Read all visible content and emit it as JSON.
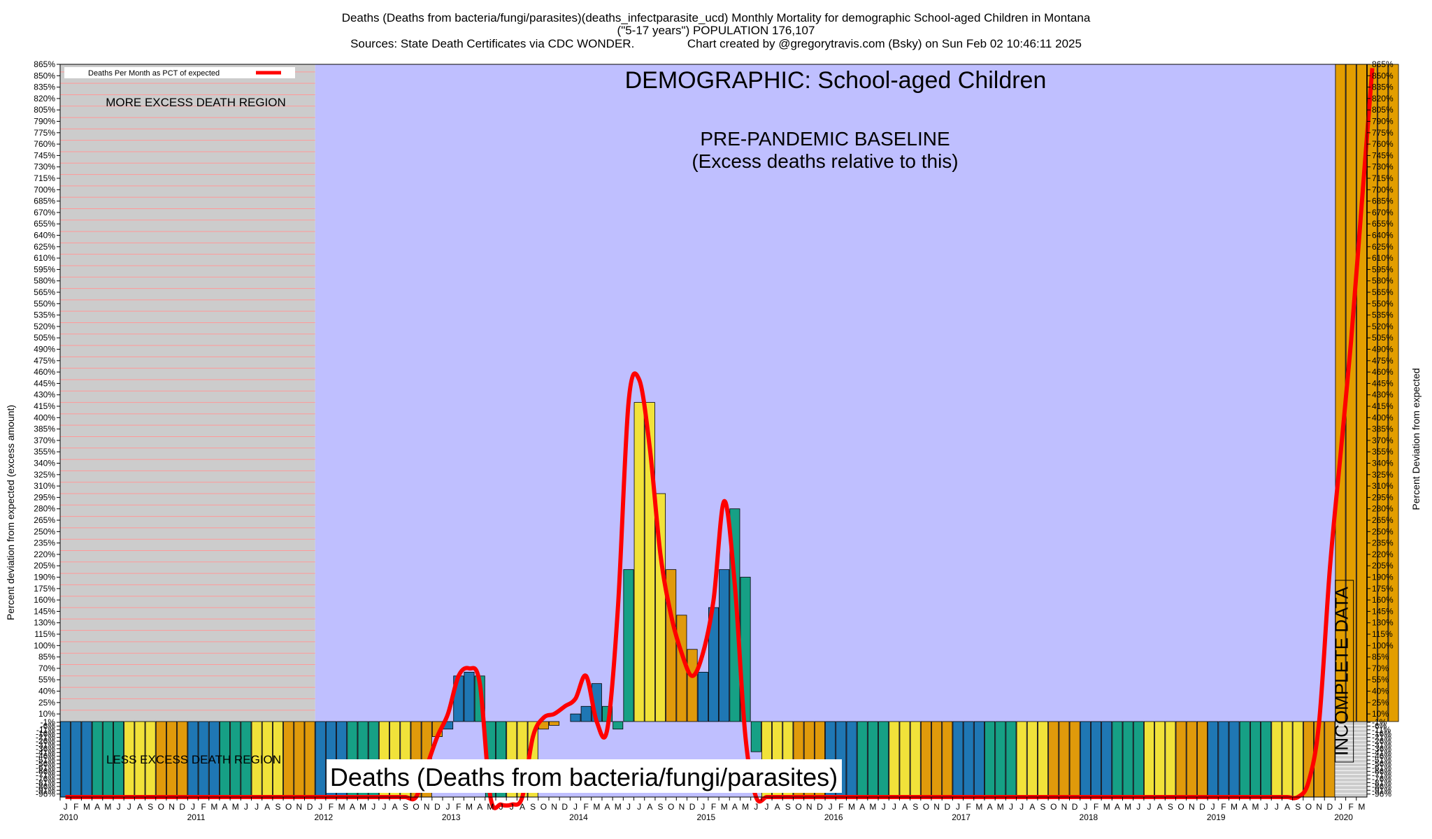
{
  "header": {
    "line1": "Deaths (Deaths from bacteria/fungi/parasites)(deaths_infectparasite_ucd) Monthly Mortality for demographic School-aged Children in Montana",
    "line2": "(\"5-17 years\") POPULATION 176,107",
    "line3": "Sources: State Death Certificates via CDC WONDER.                Chart created by @gregorytravis.com (Bsky) on Sun Feb 02 10:46:11 2025"
  },
  "chart_data": {
    "type": "bar",
    "title": "DEMOGRAPHIC: School-aged Children",
    "ylabel": "Percent deviation from expected (excess amount)",
    "ylabel_right": "Percent Deviation from expected",
    "ylim": [
      -100,
      865
    ],
    "legend": {
      "label": "Deaths Per Month as PCT of expected",
      "placement": "top-left"
    },
    "annotations": {
      "more_excess": "MORE EXCESS DEATH REGION",
      "less_excess": "LESS EXCESS DEATH REGION",
      "baseline_line1": "PRE-PANDEMIC BASELINE",
      "baseline_line2": "(Excess deaths relative to this)",
      "incomplete": "INCOMPLETE DATA",
      "bottom_title": "Deaths (Deaths from bacteria/fungi/parasites)"
    },
    "month_letters": [
      "J",
      "F",
      "M",
      "A",
      "M",
      "J",
      "J",
      "A",
      "S",
      "O",
      "N",
      "D"
    ],
    "year_labels": [
      "2010",
      "2011",
      "2012",
      "2013",
      "2014",
      "2015",
      "2016",
      "2017",
      "2018",
      "2019",
      "2020"
    ],
    "start": "2010-01",
    "values": [
      -100,
      -100,
      -100,
      -100,
      -100,
      -100,
      -100,
      -100,
      -100,
      -100,
      -100,
      -100,
      -100,
      -100,
      -100,
      -100,
      -100,
      -100,
      -100,
      -100,
      -100,
      -100,
      -100,
      -100,
      -100,
      -100,
      -100,
      -100,
      -100,
      -100,
      -100,
      -100,
      -100,
      -100,
      -100,
      -20,
      -10,
      60,
      65,
      60,
      -100,
      -100,
      -100,
      -100,
      -100,
      -10,
      -5,
      0,
      10,
      20,
      50,
      20,
      -10,
      200,
      420,
      420,
      300,
      200,
      140,
      95,
      65,
      150,
      200,
      280,
      190,
      -40,
      -100,
      -100,
      -100,
      -100,
      -100,
      -100,
      -100,
      -100,
      -100,
      -100,
      -100,
      -100,
      -100,
      -100,
      -100,
      -100,
      -100,
      -100,
      -100,
      -100,
      -100,
      -100,
      -100,
      -100,
      -100,
      -100,
      -100,
      -100,
      -100,
      -100,
      -100,
      -100,
      -100,
      -100,
      -100,
      -100,
      -100,
      -100,
      -100,
      -100,
      -100,
      -100,
      -100,
      -100,
      -100,
      -100,
      -100,
      -100,
      -100,
      -100,
      -100,
      -100,
      -100,
      -100,
      865,
      865,
      865,
      865,
      865,
      865
    ],
    "line_values": [
      -100,
      -100,
      -100,
      -100,
      -100,
      -100,
      -100,
      -100,
      -100,
      -100,
      -100,
      -100,
      -100,
      -100,
      -100,
      -100,
      -100,
      -100,
      -100,
      -100,
      -100,
      -100,
      -100,
      -100,
      -100,
      -100,
      -100,
      -100,
      -100,
      -100,
      -100,
      -100,
      -100,
      -100,
      -60,
      -20,
      10,
      60,
      70,
      50,
      -100,
      -130,
      -130,
      -100,
      -20,
      5,
      10,
      20,
      30,
      60,
      0,
      -10,
      150,
      420,
      450,
      360,
      220,
      140,
      90,
      60,
      90,
      160,
      290,
      180,
      -20,
      -100,
      -100,
      -100,
      -100,
      -100,
      -100,
      -100,
      -100,
      -100,
      -100,
      -100,
      -100,
      -100,
      -100,
      -100,
      -100,
      -100,
      -100,
      -100,
      -100,
      -100,
      -100,
      -100,
      -100,
      -100,
      -100,
      -100,
      -100,
      -100,
      -100,
      -100,
      -100,
      -100,
      -100,
      -100,
      -100,
      -100,
      -100,
      -100,
      -100,
      -100,
      -100,
      -100,
      -100,
      -100,
      -100,
      -100,
      -100,
      -100,
      -100,
      -100,
      -100,
      -80,
      0,
      200,
      350,
      500,
      680,
      860
    ]
  },
  "colors": {
    "baseline_bg": "#bfbfff",
    "excess_bg": "#cccccc",
    "grid_line": "#ff9999",
    "line": "#ff0000",
    "bar_palette": [
      "#1f77b4",
      "#1f77b4",
      "#1f77b4",
      "#16a085",
      "#16a085",
      "#16a085",
      "#f1e23a",
      "#f1e23a",
      "#f1e23a",
      "#e09a0b",
      "#e09a0b",
      "#e09a0b"
    ],
    "incomplete_bar": "#e39e00"
  }
}
